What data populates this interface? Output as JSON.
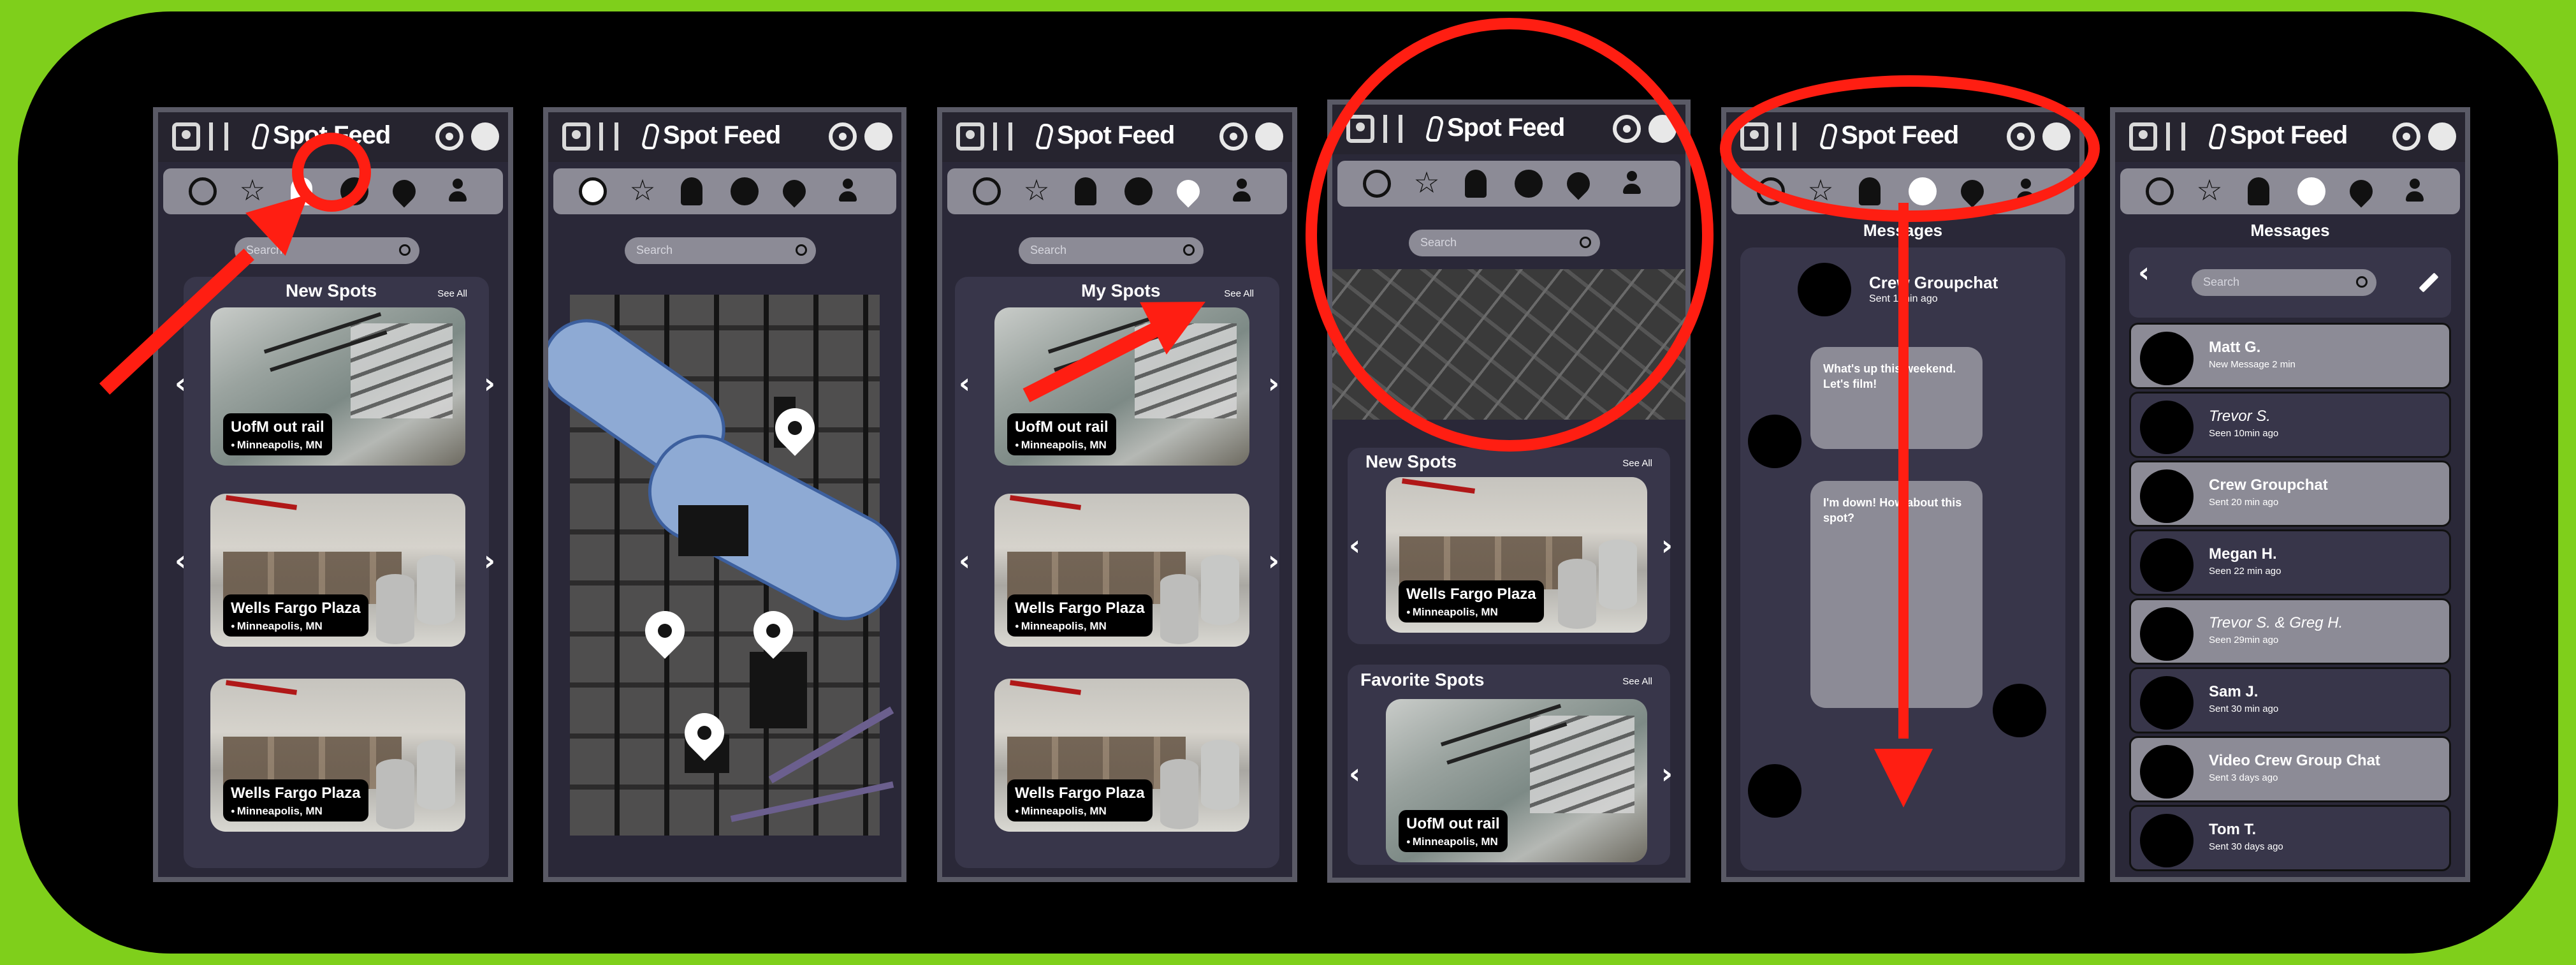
{
  "app": {
    "logo_text": "Spot Feed"
  },
  "common": {
    "search_placeholder": "Search",
    "see_all": "See All",
    "prev_arrow": "‹",
    "next_arrow": "›"
  },
  "screens": {
    "notifications": {
      "section_title": "New Spots",
      "cards": [
        {
          "title": "UofM out rail",
          "location": "Minneapolis, MN",
          "image": "rail-stairs-photo"
        },
        {
          "title": "Wells Fargo Plaza",
          "location": "Minneapolis, MN",
          "image": "plaza-photo"
        },
        {
          "title": "Wells Fargo Plaza",
          "location": "Minneapolis, MN",
          "image": "plaza-photo"
        }
      ]
    },
    "map": {
      "pins": 4
    },
    "my_spots": {
      "section_title": "My Spots",
      "cards": [
        {
          "title": "UofM out rail",
          "location": "Minneapolis, MN"
        },
        {
          "title": "Wells Fargo Plaza",
          "location": "Minneapolis, MN"
        },
        {
          "title": "Wells Fargo Plaza",
          "location": "Minneapolis, MN"
        }
      ]
    },
    "home": {
      "new_spots_title": "New Spots",
      "favorite_spots_title": "Favorite Spots",
      "new_card": {
        "title": "Wells Fargo Plaza",
        "location": "Minneapolis, MN"
      },
      "favorite_card": {
        "title": "UofM out rail",
        "location": "Minneapolis, MN"
      }
    },
    "chat": {
      "header_title": "Messages",
      "group_name": "Crew Groupchat",
      "group_sub": "Sent 1 min ago",
      "messages": [
        "What's up this weekend. Let's film!",
        "I'm down! How about this spot?"
      ]
    },
    "messages": {
      "title": "Messages",
      "rows": [
        {
          "name": "Matt G.",
          "sub": "New Message 2 min",
          "style": "light"
        },
        {
          "name": "Trevor S.",
          "sub": "Seen 10min ago",
          "style": "dark",
          "italic": true
        },
        {
          "name": "Crew Groupchat",
          "sub": "Sent 20 min ago",
          "style": "light"
        },
        {
          "name": "Megan H.",
          "sub": "Seen 22 min ago",
          "style": "dark"
        },
        {
          "name": "Trevor S. & Greg H.",
          "sub": "Seen 29min ago",
          "style": "light",
          "italic": true
        },
        {
          "name": "Sam J.",
          "sub": "Sent 30 min ago",
          "style": "dark"
        },
        {
          "name": "Video Crew Group Chat",
          "sub": "Sent 3 days ago",
          "style": "light"
        },
        {
          "name": "Tom T.",
          "sub": "Sent 30 days ago",
          "style": "dark"
        }
      ]
    }
  },
  "colors": {
    "frame_green": "#7fcf1b",
    "annotation_red": "#ff1e12",
    "panel": "#2a2838",
    "tab_bar": "#8c8b96"
  }
}
